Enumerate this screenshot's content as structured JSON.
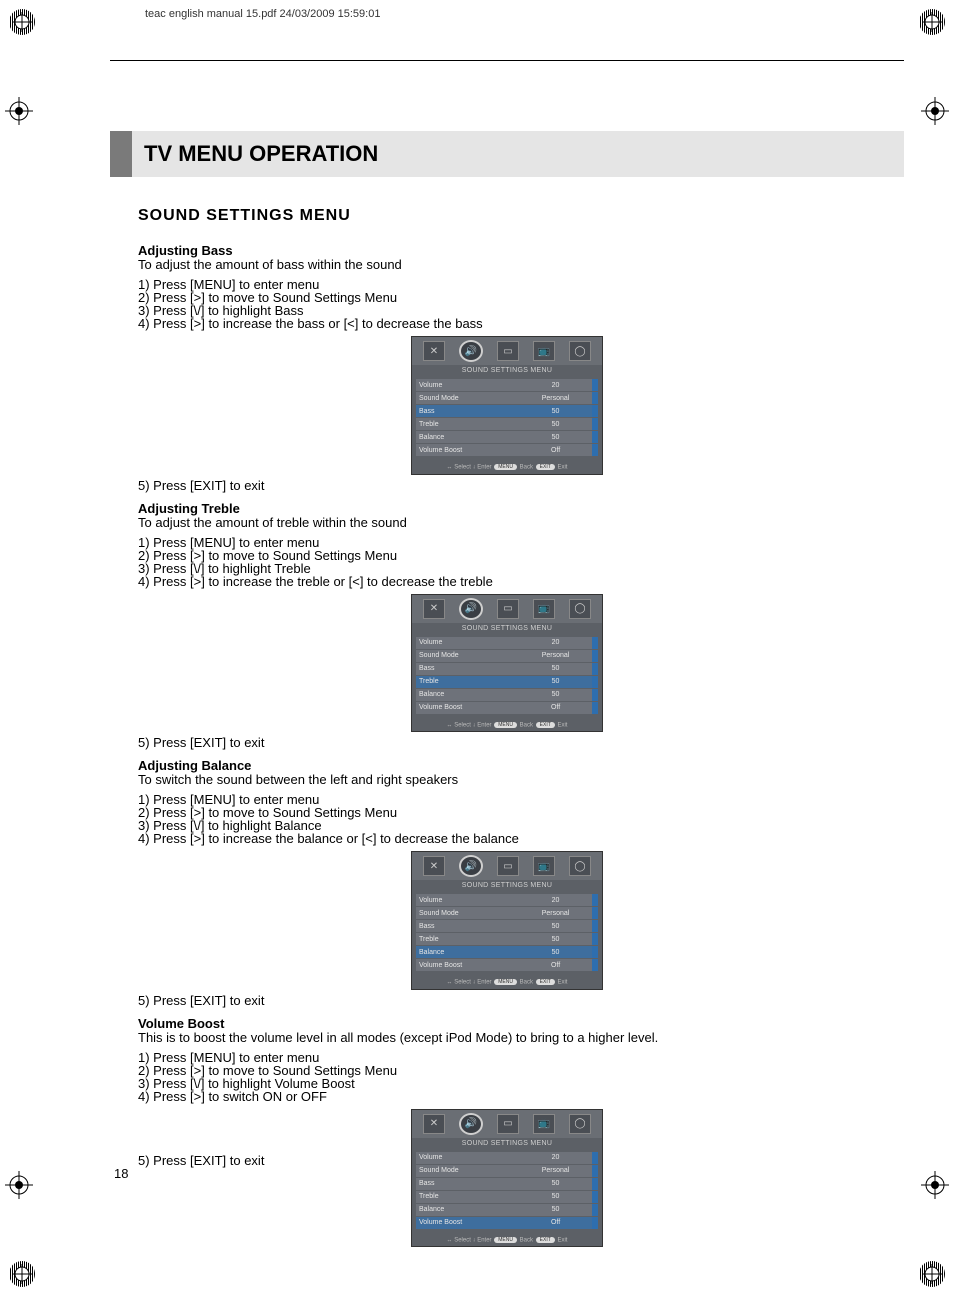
{
  "slugline": "teac english manual 15.pdf   24/03/2009   15:59:01",
  "page_number": "18",
  "titlebar": "TV MENU OPERATION",
  "h2": "SOUND SETTINGS MENU",
  "sections": {
    "bass": {
      "heading": "Adjusting Bass",
      "desc": "To adjust the amount of bass within the sound",
      "steps": [
        "1) Press [MENU] to enter menu",
        "2) Press [>] to move to Sound Settings Menu",
        "3) Press [\\/] to highlight Bass",
        "4) Press [>] to increase the bass or [<] to decrease the bass"
      ],
      "after": "5) Press [EXIT] to exit",
      "highlight": "Bass"
    },
    "treble": {
      "heading": "Adjusting Treble",
      "desc": "To adjust the amount of treble within the sound",
      "steps": [
        "1) Press [MENU] to enter menu",
        "2) Press [>] to move to Sound Settings Menu",
        "3) Press [\\/] to highlight Treble",
        "4) Press [>] to increase the treble or [<] to decrease the treble"
      ],
      "after": "5) Press [EXIT] to exit",
      "highlight": "Treble"
    },
    "balance": {
      "heading": "Adjusting Balance",
      "desc": "To switch the sound between the left and right speakers",
      "steps": [
        "1) Press [MENU] to enter menu",
        "2) Press [>] to move to Sound Settings Menu",
        "3) Press [\\/] to highlight Balance",
        "4) Press [>] to increase the balance or [<] to decrease the balance"
      ],
      "after": "5) Press [EXIT] to exit",
      "highlight": "Balance"
    },
    "volboost": {
      "heading": "Volume Boost",
      "desc": "This is to boost the volume level in all modes (except iPod Mode) to bring to a higher level.",
      "steps": [
        "1) Press [MENU] to enter menu",
        "2) Press [>] to move to Sound Settings Menu",
        "3) Press [\\/] to highlight Volume Boost",
        "4) Press [>] to switch ON or OFF"
      ],
      "after": "5) Press [EXIT] to exit",
      "highlight": "Volume Boost"
    }
  },
  "osd": {
    "title": "SOUND SETTINGS MENU",
    "rows": [
      {
        "label": "Volume",
        "value": "20"
      },
      {
        "label": "Sound Mode",
        "value": "Personal"
      },
      {
        "label": "Bass",
        "value": "50"
      },
      {
        "label": "Treble",
        "value": "50"
      },
      {
        "label": "Balance",
        "value": "50"
      },
      {
        "label": "Volume Boost",
        "value": "Off"
      }
    ],
    "footer_select": "Select",
    "footer_enter": "Enter",
    "footer_menu": "MENU",
    "footer_back": "Back",
    "footer_exit_pill": "EXIT",
    "footer_exit": "Exit"
  }
}
